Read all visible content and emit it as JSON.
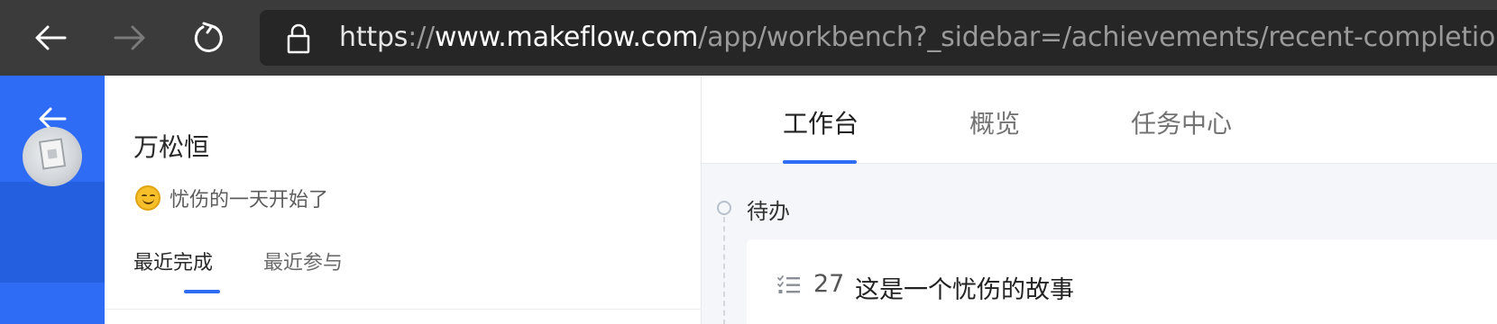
{
  "browser": {
    "url_scheme": "https",
    "url_sep": "://",
    "url_host": "www.makeflow.com",
    "url_path": "/app/workbench?_sidebar=/achievements/recent-completion",
    "icons": [
      "back-arrow-icon",
      "forward-arrow-icon",
      "reload-icon",
      "lock-icon"
    ]
  },
  "rail": {
    "icons": [
      "back-arrow-icon"
    ],
    "avatar_icon": "avatar"
  },
  "profile": {
    "name": "万松恒",
    "status_icon": "smiling-face-emoji",
    "status_text": "忧伤的一天开始了",
    "tabs": [
      {
        "label": "最近完成",
        "active": true
      },
      {
        "label": "最近参与",
        "active": false
      }
    ]
  },
  "main": {
    "tabs": [
      {
        "label": "工作台",
        "active": true
      },
      {
        "label": "概览",
        "active": false
      },
      {
        "label": "任务中心",
        "active": false
      }
    ],
    "section_title": "待办",
    "task": {
      "icon": "checklist-icon",
      "id": "27",
      "title": "这是一个忧伤的故事"
    }
  },
  "colors": {
    "accent": "#2f6cf6",
    "browser_bar": "#3b3b3b",
    "address_bar": "#262626",
    "main_bg": "#f4f6f9"
  }
}
